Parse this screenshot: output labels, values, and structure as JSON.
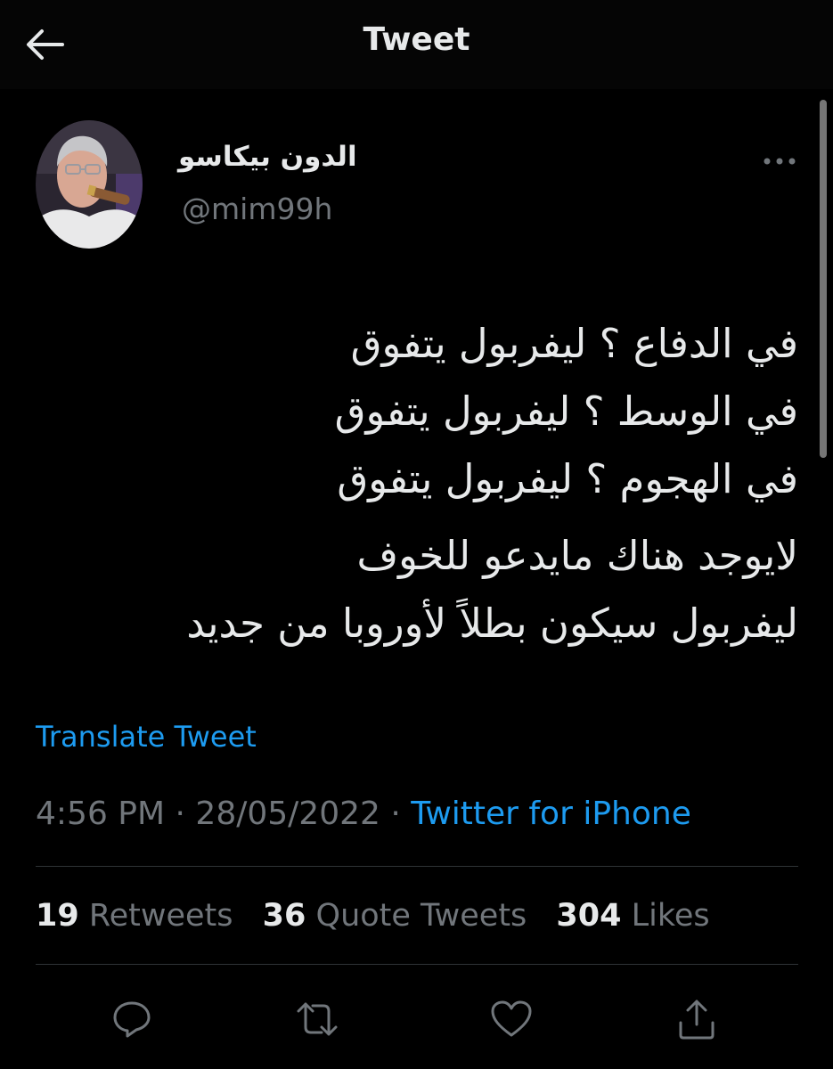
{
  "header": {
    "title": "Tweet",
    "back_icon": "arrow-left-icon"
  },
  "tweet": {
    "author": {
      "display_name": "الدون بيكاسو",
      "handle": "@mim99h"
    },
    "body_paragraphs": [
      [
        "في الدفاع ؟ ليفربول يتفوق",
        "في الوسط ؟ ليفربول يتفوق",
        "في الهجوم ؟ ليفربول يتفوق"
      ],
      [
        "لايوجد هناك مايدعو للخوف",
        "ليفربول سيكون بطلاً لأوروبا من جديد"
      ]
    ],
    "translate_label": "Translate Tweet",
    "time": "4:56 PM",
    "date": "28/05/2022",
    "separator": "·",
    "source": "Twitter for iPhone",
    "stats": {
      "retweets_count": "19",
      "retweets_label": "Retweets",
      "quotes_count": "36",
      "quotes_label": "Quote Tweets",
      "likes_count": "304",
      "likes_label": "Likes"
    }
  },
  "actions": [
    {
      "icon": "reply-icon"
    },
    {
      "icon": "retweet-icon"
    },
    {
      "icon": "like-icon"
    },
    {
      "icon": "share-icon"
    }
  ],
  "colors": {
    "background": "#000000",
    "text": "#e7e9ea",
    "secondary_text": "#71767b",
    "accent": "#1d9bf0",
    "divider": "#2f3336"
  }
}
